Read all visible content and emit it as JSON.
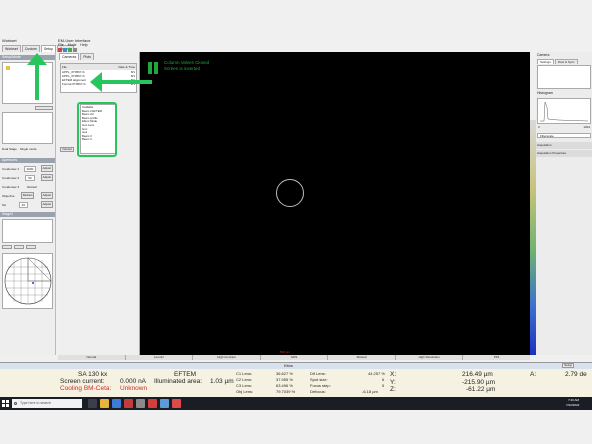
{
  "left_window": {
    "title": "Workset",
    "tabs": [
      "Workset",
      "Custom",
      "Setup",
      "Search",
      "Tune"
    ],
    "sections": {
      "setup_title": "Setup/Mode",
      "apertures_title": "Apertures",
      "stage_title": "Stage2"
    },
    "setup": {
      "checkbox1": "Dual Stage",
      "checkbox2": "Single mode"
    },
    "apertures": {
      "rows": [
        {
          "label": "Condenser 1",
          "value": "2000",
          "btn": "Adjust"
        },
        {
          "label": "Condenser 2",
          "value": "50",
          "btn": "Adjust"
        },
        {
          "label": "Condenser 3",
          "value": "Retract",
          "btn": ""
        },
        {
          "label": "Objective",
          "value": "Retract",
          "btn": "Adjust"
        },
        {
          "label": "SA",
          "value": "40",
          "btn": "Adjust"
        }
      ]
    }
  },
  "center_window": {
    "title": "EM-User Interface",
    "menu": [
      "File",
      "Mode",
      "Help"
    ],
    "tabs": [
      "Cameras",
      "Plots"
    ],
    "overlay_line1": "Column Valves Closed",
    "overlay_line2": "Screen is inserted",
    "scale_text": "500 nm",
    "table_header": [
      "File",
      "Date & Time"
    ],
    "table_rows": [
      {
        "name": "APPL_0T0567-S",
        "date": "8/1"
      },
      {
        "name": "APPL_0T0567-S",
        "date": "8/1"
      },
      {
        "name": "EFTEM alignment",
        "date": "8/1"
      },
      {
        "name": "Format 0T0567-S",
        "date": "2/1"
      }
    ],
    "list_items": [
      "Available",
      "Beam 2 EFTEM",
      "Beam ctrl",
      "Beam profile",
      "Eftem Mode",
      "Gun Lens",
      "Gun",
      "Jeol",
      "Beam 3",
      "Beam 4"
    ],
    "list_btn": "Cancel",
    "bottom_tabs": [
      "Normal",
      "Lorentz",
      "High Contrast",
      "GDS",
      "Manual",
      "High Resolution",
      "PP1"
    ]
  },
  "right_panel": {
    "title": "Camera",
    "tabs": [
      "Settings",
      "Flow & Sync"
    ],
    "histogram_title": "Histogram",
    "dropdown_value": "Filterscale",
    "section1": "Acquisition",
    "section2": "Acquisition Properties",
    "min_label": "0",
    "max_label": "1024"
  },
  "status_bar": {
    "title": "Kitos",
    "mag": "SA 130 kx",
    "mode": "EFTEM",
    "screen_current_label": "Screen current:",
    "screen_current_value": "0.000 nA",
    "illum_label": "Illuminated area:",
    "illum_value": "1.03 µm",
    "cooling_label": "Cooling BM-Ceta:",
    "cooling_value": "Unknown",
    "lenses": [
      {
        "label": "C1 Lens:",
        "value": "36.627 %",
        "label2": "Dif Lens:",
        "value2": "44.257 %"
      },
      {
        "label": "C2 Lens:",
        "value": "37.955 %",
        "label2": "Spot size:",
        "value2": "6"
      },
      {
        "label": "C3 Lens:",
        "value": "63.496 %",
        "label2": "Focus step:",
        "value2": "5"
      },
      {
        "label": "Obj Lens:",
        "value": "79.7039 %",
        "label2": "Defocus:",
        "value2": "-6.18 µm"
      }
    ],
    "stage": {
      "x_label": "X:",
      "x_value": "216.49 µm",
      "y_label": "Y:",
      "y_value": "-215.90 µm",
      "z_label": "Z:",
      "z_value": "-61.22 µm",
      "a_label": "A:",
      "a_value": "2.79 de"
    },
    "side_btn": "Setup"
  },
  "taskbar": {
    "search": "Type here to search",
    "time": "7:20 AM",
    "date": "7/22/2022"
  },
  "colors": {
    "arrow": "#28c45e",
    "overlay_text": "#1fa83a",
    "warning": "#d62a2a"
  }
}
